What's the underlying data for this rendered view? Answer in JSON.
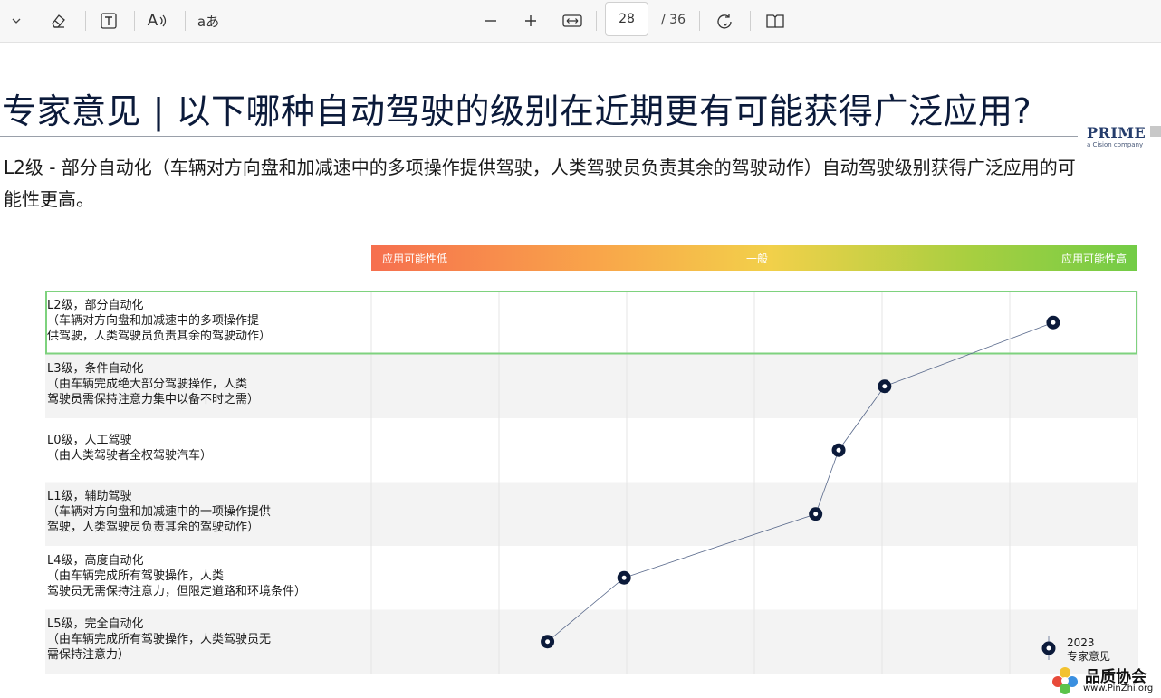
{
  "toolbar": {
    "page_current": "28",
    "page_total": "/ 36",
    "icons": [
      "chevron-down-icon",
      "eraser-icon",
      "text-box-icon",
      "read-aloud-icon",
      "translate-icon",
      "zoom-out-icon",
      "zoom-in-icon",
      "fit-width-icon",
      "rotate-icon",
      "page-view-icon"
    ],
    "readaloud_glyph": "A",
    "translate_glyph": "aあ"
  },
  "slide": {
    "title": "专家意见 | 以下哪种自动驾驶的级别在近期更有可能获得广泛应用?",
    "subtitle": "L2级 - 部分自动化（车辆对方向盘和加减速中的多项操作提供驾驶，人类驾驶员负责其余的驾驶动作）自动驾驶级别获得广泛应用的可能性更高。",
    "logo_main": "PRIME",
    "logo_sub": "a Cision company"
  },
  "chart_data": {
    "type": "line",
    "scale_labels": {
      "low": "应用可能性低",
      "mid": "一般",
      "high": "应用可能性高"
    },
    "colors": {
      "gradient_start": "#f66f4e",
      "gradient_mid": "#f2d04a",
      "gradient_end": "#72cc46",
      "marker": "#0b1a3a",
      "highlight_border": "#7ed27e"
    },
    "categories": [
      {
        "lines": [
          "L2级，部分自动化",
          "（车辆对方向盘和加减速中的多项操作提",
          "供驾驶，人类驾驶员负责其余的驾驶动作）"
        ]
      },
      {
        "lines": [
          "L3级，条件自动化",
          "（由车辆完成绝大部分驾驶操作，人类",
          "驾驶员需保持注意力集中以备不时之需）"
        ]
      },
      {
        "lines": [
          "L0级，人工驾驶",
          "（由人类驾驶者全权驾驶汽车）"
        ]
      },
      {
        "lines": [
          "L1级，辅助驾驶",
          "（车辆对方向盘和加减速中的一项操作提供",
          "驾驶，人类驾驶员负责其余的驾驶动作）"
        ]
      },
      {
        "lines": [
          "L4级，高度自动化",
          "（由车辆完成所有驾驶操作，人类",
          "驾驶员无需保持注意力，但限定道路和环境条件）"
        ]
      },
      {
        "lines": [
          "L5级，完全自动化",
          "（由车辆完成所有驾驶操作，人类驾驶员无",
          "需保持注意力）"
        ]
      }
    ],
    "values": [
      0.89,
      0.67,
      0.61,
      0.58,
      0.33,
      0.23
    ],
    "xlim": [
      0,
      1
    ],
    "highlight_index": 0,
    "legend": {
      "line1": "2023",
      "line2": "专家意见"
    }
  },
  "watermark": {
    "cn": "品质协会",
    "url": "www.PinZhi.org"
  }
}
